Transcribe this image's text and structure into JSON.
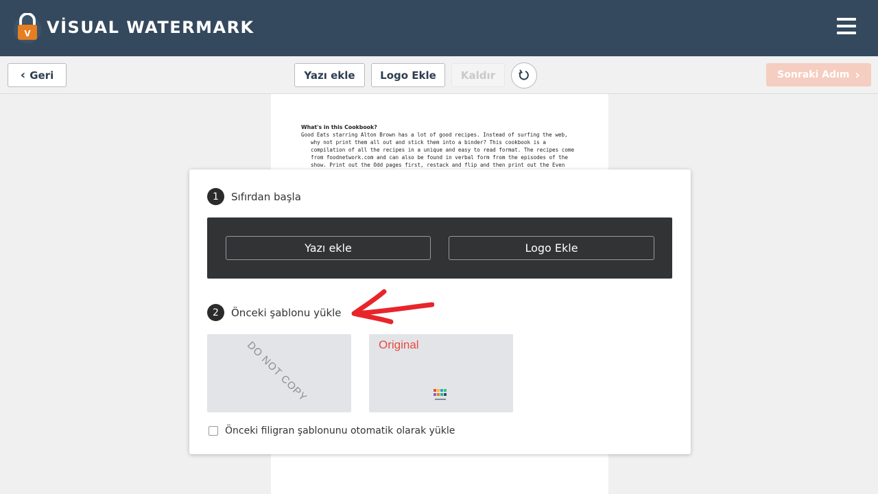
{
  "header": {
    "brand": "VİSUAL WATERMARK",
    "logo_icon": "lock-v-icon",
    "menu_icon": "hamburger-icon",
    "color": "#34495e"
  },
  "toolbar": {
    "back_label": "Geri",
    "add_text_label": "Yazı ekle",
    "add_logo_label": "Logo Ekle",
    "remove_label": "Kaldır",
    "reset_icon": "undo-icon",
    "next_label": "Sonraki Adım",
    "next_color": "#f5cdc1"
  },
  "document": {
    "title": "What's in this Cookbook?",
    "text": "Good Eats starring Alton Brown has a lot of good recipes. Instead of surfing the web, why not print them all out and stick them into a binder? This cookbook is a compilation of all the recipes in a unique and easy to read format. The recipes come from foodnetwork.com and can also be found in verbal form from the episodes of the show. Print out the Odd pages first, restack and flip and then print out the Even pages next."
  },
  "modal": {
    "step1": {
      "number": "1",
      "label": "Sıfırdan başla"
    },
    "add_text_button": "Yazı ekle",
    "add_logo_button": "Logo Ekle",
    "step2": {
      "number": "2",
      "label": "Önceki şablonu yükle"
    },
    "arrow_color": "#e8252b",
    "templates": [
      {
        "watermark_text": "DO NOT COPY"
      },
      {
        "watermark_text": "Original",
        "color": "#e74c3c"
      }
    ],
    "autoload_label": "Önceki filigran şablonunu otomatik olarak yükle",
    "autoload_checked": false
  }
}
